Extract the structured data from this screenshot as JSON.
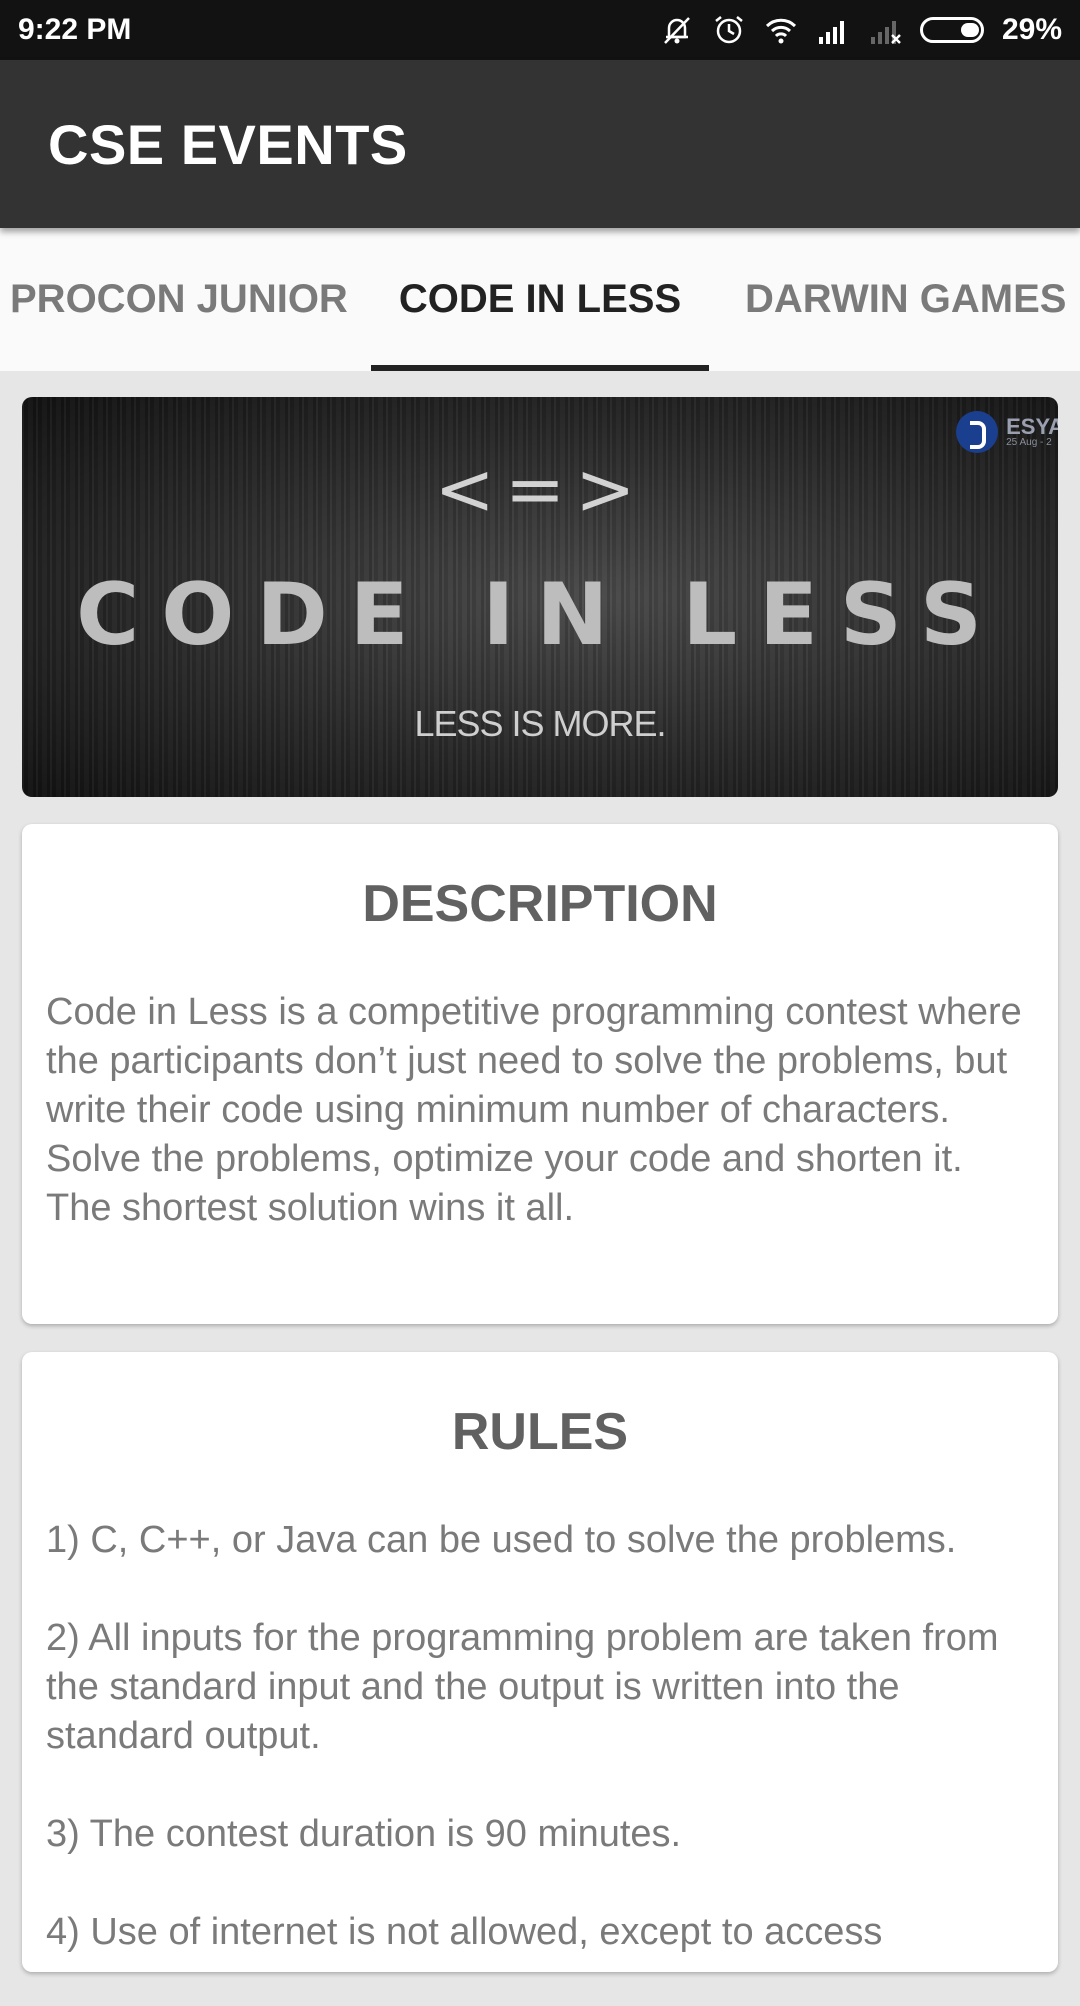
{
  "status_bar": {
    "time": "9:22 PM",
    "battery": "29%",
    "icons": [
      "bell-off-icon",
      "alarm-icon",
      "wifi-icon",
      "signal-icon",
      "signal-none-icon",
      "battery-icon"
    ]
  },
  "app_bar": {
    "title": "CSE EVENTS"
  },
  "tabs": [
    {
      "label": "PROCON JUNIOR",
      "active": false
    },
    {
      "label": "CODE IN LESS",
      "active": true
    },
    {
      "label": "DARWIN GAMES",
      "active": false
    }
  ],
  "banner": {
    "symbol": "<=>",
    "title": "CODE IN LESS",
    "tagline": "LESS IS MORE.",
    "sponsor": "ESYA",
    "sponsor_date": "25 Aug - 2"
  },
  "description": {
    "heading": "DESCRIPTION",
    "text": "Code in Less is a competitive programming contest where the participants don’t just need to solve the problems, but write their code using minimum number of characters. Solve the problems, optimize your code and shorten it. The shortest solution wins it all."
  },
  "rules": {
    "heading": "RULES",
    "items": [
      "1) C, C++, or Java can be used to solve the problems.",
      " 2) All inputs for the programming problem are taken from the standard input and the output is written into the standard output.",
      " 3) The contest duration is 90 minutes.",
      " 4) Use of internet is not allowed, except to access"
    ]
  },
  "colors": {
    "status_bar": "#121212",
    "app_bar": "#333333",
    "tab_bg": "#fafafa",
    "active_tab": "#222222",
    "inactive_tab": "#7a7a7a",
    "page_bg": "#e6e6e6"
  }
}
